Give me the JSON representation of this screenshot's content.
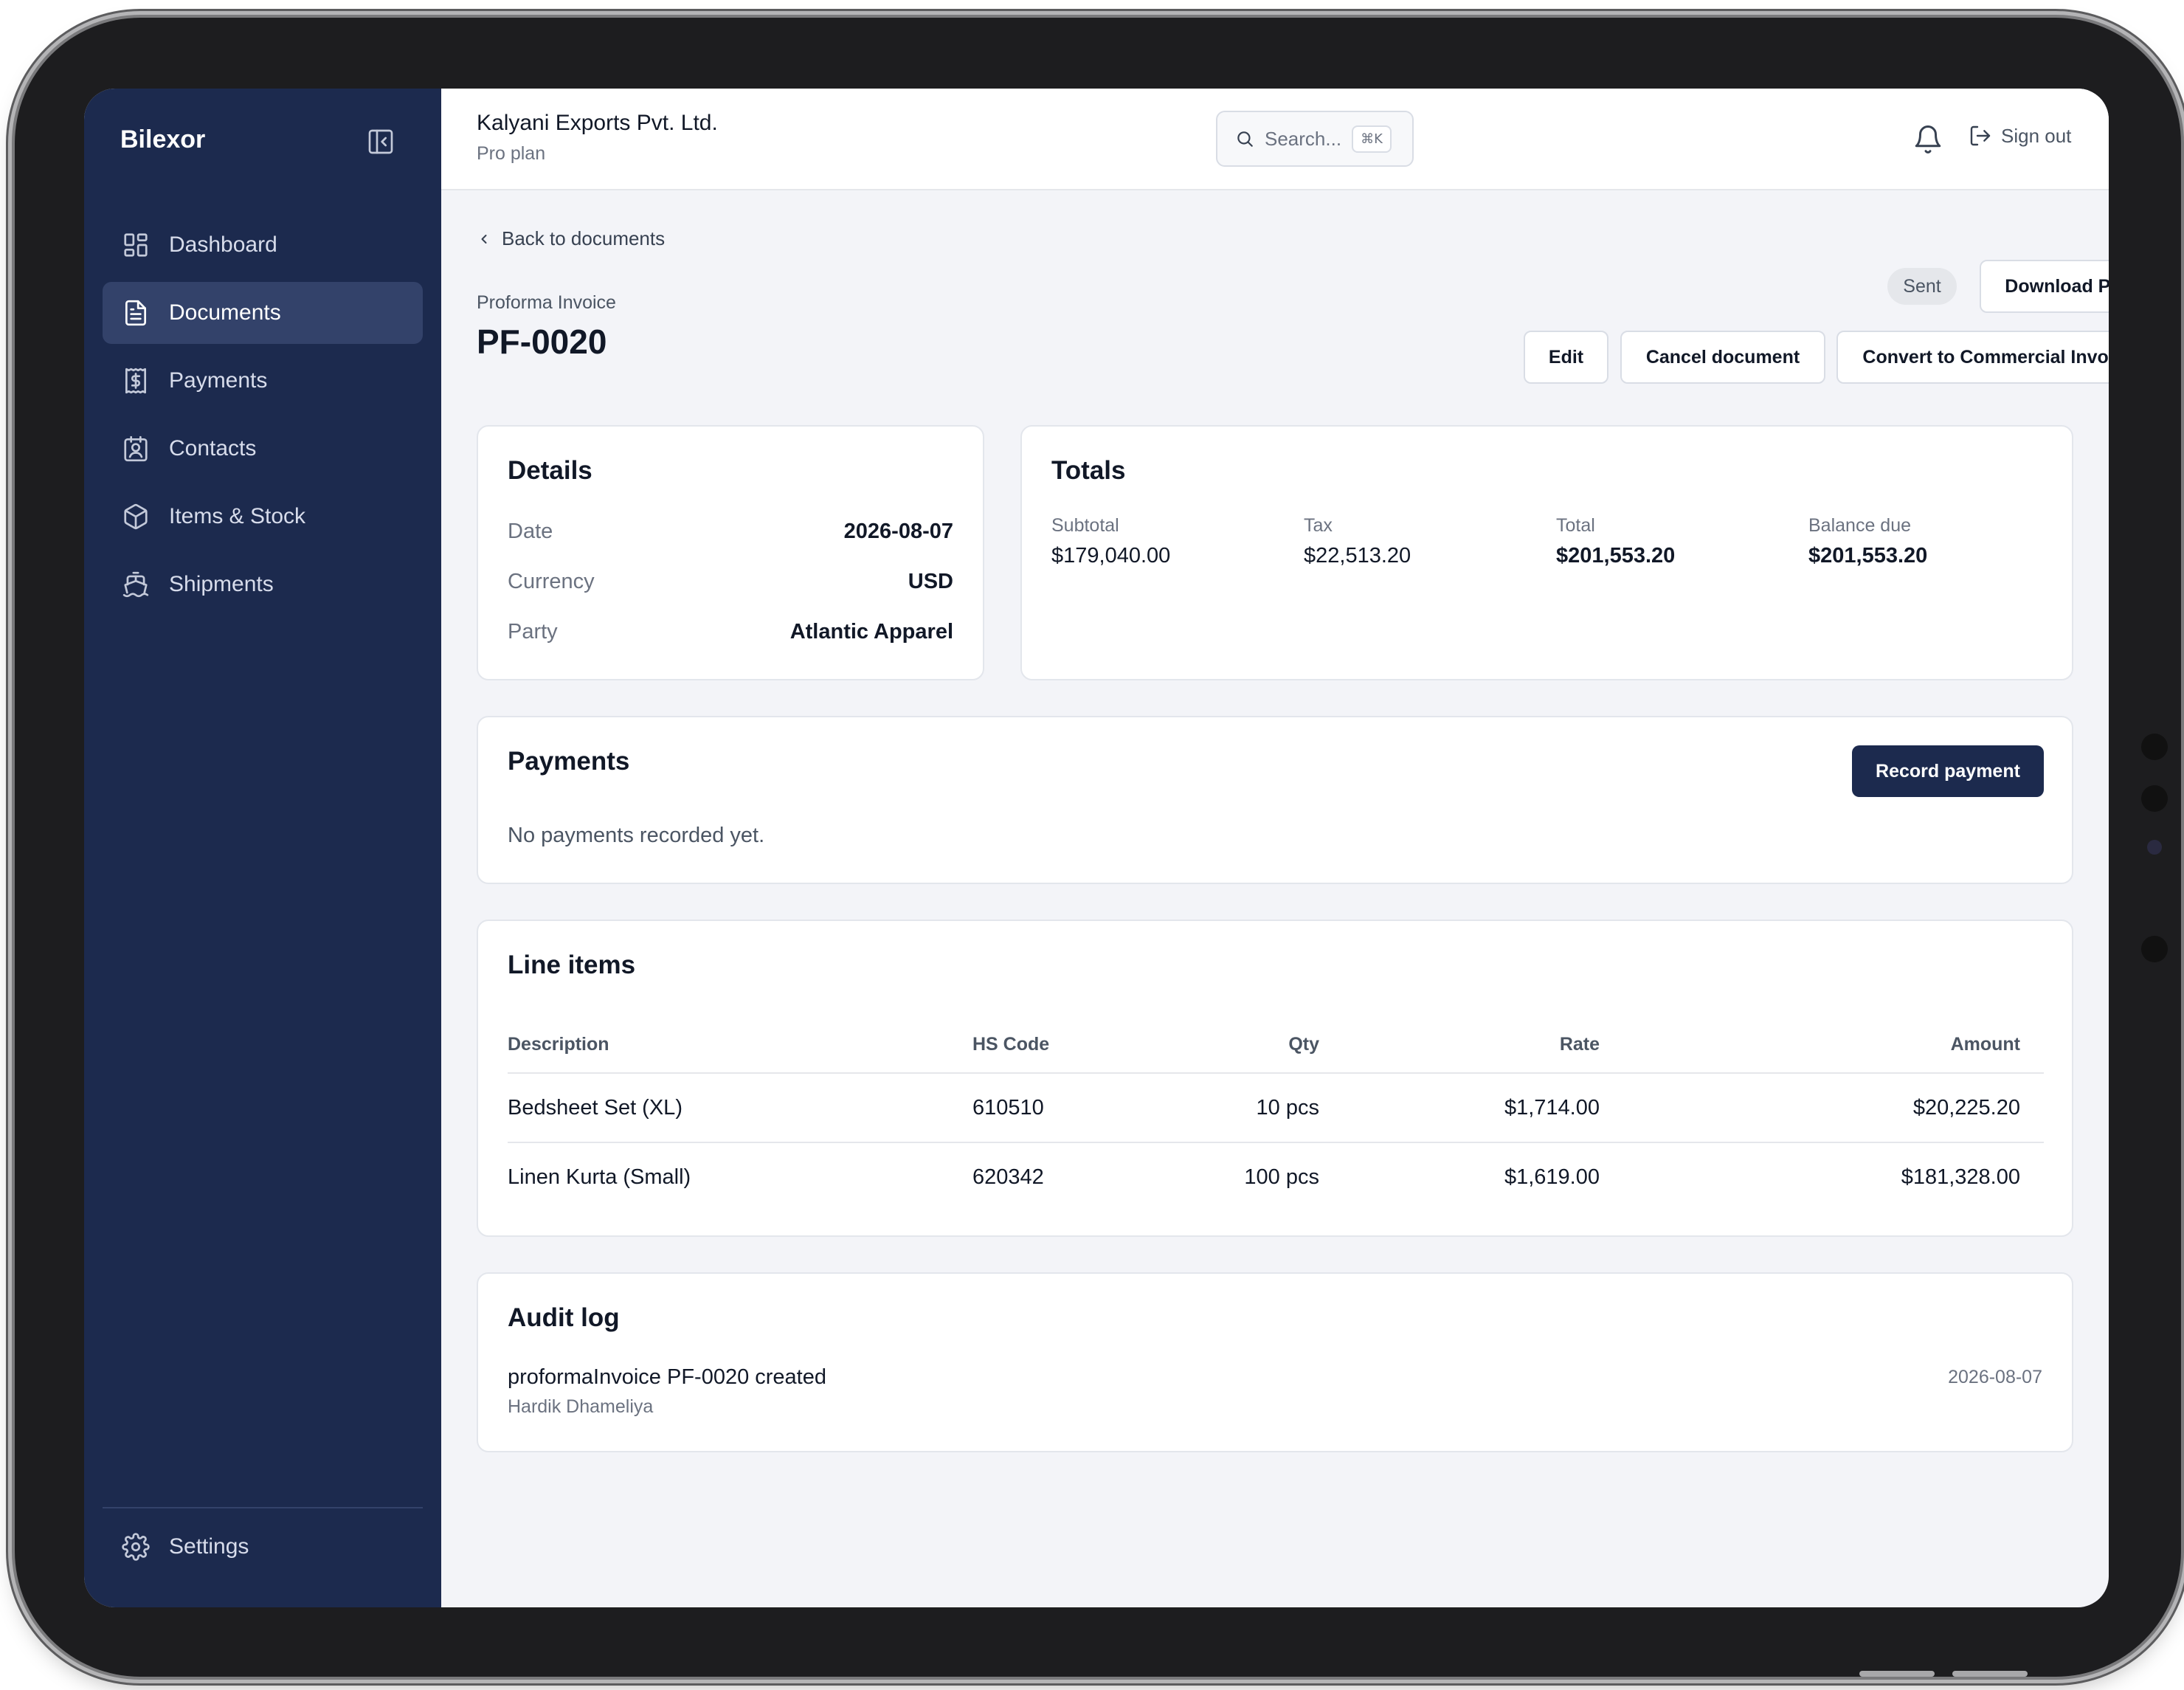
{
  "app": {
    "brand": "Bilexor"
  },
  "sidebar": {
    "items": [
      {
        "label": "Dashboard",
        "icon": "dashboard-icon"
      },
      {
        "label": "Documents",
        "icon": "document-icon",
        "active": true
      },
      {
        "label": "Payments",
        "icon": "dollar-receipt-icon"
      },
      {
        "label": "Contacts",
        "icon": "contact-card-icon"
      },
      {
        "label": "Items & Stock",
        "icon": "package-icon"
      },
      {
        "label": "Shipments",
        "icon": "ship-icon"
      }
    ],
    "settings_label": "Settings"
  },
  "header": {
    "company": "Kalyani Exports Pvt. Ltd.",
    "plan": "Pro plan",
    "search_placeholder": "Search...",
    "search_shortcut": "⌘K",
    "signout_label": "Sign out"
  },
  "page": {
    "back_label": "Back to documents",
    "doc_type": "Proforma Invoice",
    "doc_number": "PF-0020",
    "status": "Sent",
    "actions": {
      "download": "Download PDF",
      "edit": "Edit",
      "cancel": "Cancel document",
      "convert": "Convert to Commercial Invoice"
    }
  },
  "details": {
    "title": "Details",
    "rows": [
      {
        "key": "Date",
        "value": "2026-08-07"
      },
      {
        "key": "Currency",
        "value": "USD"
      },
      {
        "key": "Party",
        "value": "Atlantic Apparel"
      }
    ]
  },
  "totals": {
    "title": "Totals",
    "items": [
      {
        "label": "Subtotal",
        "value": "$179,040.00"
      },
      {
        "label": "Tax",
        "value": "$22,513.20"
      },
      {
        "label": "Total",
        "value": "$201,553.20"
      },
      {
        "label": "Balance due",
        "value": "$201,553.20"
      }
    ]
  },
  "payments": {
    "title": "Payments",
    "record_label": "Record payment",
    "empty_message": "No payments recorded yet."
  },
  "line_items": {
    "title": "Line items",
    "columns": [
      "Description",
      "HS Code",
      "Qty",
      "Rate",
      "Amount"
    ],
    "rows": [
      [
        "Bedsheet Set (XL)",
        "610510",
        "10 pcs",
        "$1,714.00",
        "$20,225.20"
      ],
      [
        "Linen Kurta (Small)",
        "620342",
        "100 pcs",
        "$1,619.00",
        "$181,328.00"
      ]
    ]
  },
  "audit_log": {
    "title": "Audit log",
    "entries": [
      {
        "text": "proformaInvoice PF-0020 created",
        "user": "Hardik Dhameliya",
        "date": "2026-08-07"
      }
    ]
  }
}
